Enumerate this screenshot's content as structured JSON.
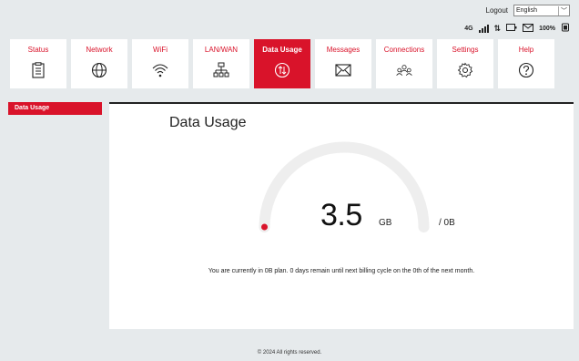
{
  "header": {
    "logout_label": "Logout",
    "language_selected": "English",
    "status": {
      "network_type": "4G",
      "battery_text": "100%"
    }
  },
  "nav": {
    "items": [
      {
        "label": "Status",
        "icon": "clipboard-icon"
      },
      {
        "label": "Network",
        "icon": "globe-icon"
      },
      {
        "label": "WiFi",
        "icon": "wifi-icon"
      },
      {
        "label": "LAN/WAN",
        "icon": "network-tree-icon"
      },
      {
        "label": "Data Usage",
        "icon": "data-transfer-icon",
        "active": true
      },
      {
        "label": "Messages",
        "icon": "envelope-icon"
      },
      {
        "label": "Connections",
        "icon": "users-icon"
      },
      {
        "label": "Settings",
        "icon": "gear-icon"
      },
      {
        "label": "Help",
        "icon": "question-icon"
      }
    ]
  },
  "sidebar": {
    "items": [
      {
        "label": "Data Usage",
        "active": true
      }
    ]
  },
  "main": {
    "title": "Data Usage",
    "used_value": "3.5",
    "used_unit": "GB",
    "plan_total": "/ 0B",
    "usage_fraction": 0.0,
    "message": "You are currently in 0B plan. 0 days remain until next billing cycle on the 0th of the next month."
  },
  "footer": {
    "text": "© 2024 All rights reserved."
  },
  "colors": {
    "accent": "#d9132a",
    "background": "#e6eaec",
    "gauge_track": "#eeeeee"
  }
}
